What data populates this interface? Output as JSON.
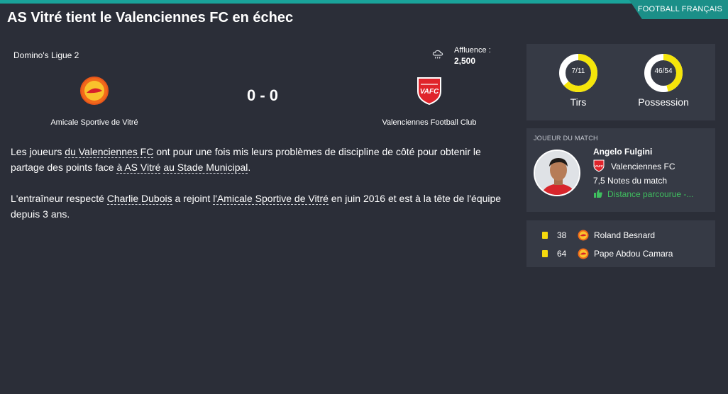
{
  "category": "FOOTBALL FRANÇAIS",
  "headline": "AS Vitré tient le Valenciennes FC en échec",
  "match": {
    "competition": "Domino's Ligue 2",
    "attendance_label": "Affluence :",
    "attendance_value": "2,500",
    "weather_icon": "cloud-rain-icon",
    "score": "0 - 0",
    "home_team": "Amicale Sportive de Vitré",
    "away_team": "Valenciennes Football Club"
  },
  "article": {
    "p1": {
      "t1": "Les joueurs ",
      "link1": "du Valenciennes FC",
      "t2": " ont pour une fois mis leurs problèmes de discipline de côté pour obtenir le partage des points face ",
      "link2": "à AS Vitré",
      "t3": " ",
      "link3": "au Stade Municipal",
      "t4": "."
    },
    "p2": {
      "t1": "L'entraîneur respecté ",
      "link1": "Charlie Dubois",
      "t2": " a rejoint ",
      "link2": "l'Amicale Sportive de Vitré",
      "t3": " en juin 2016 et est à la tête de l'équipe depuis 3 ans."
    }
  },
  "stats": [
    {
      "label": "Tirs",
      "value_text": "7/11",
      "fraction": 0.636
    },
    {
      "label": "Possession",
      "value_text": "46/54",
      "fraction": 0.46
    }
  ],
  "motm": {
    "title": "JOUEUR DU MATCH",
    "player": "Angelo Fulgini",
    "club": "Valenciennes FC",
    "rating": "7,5",
    "rating_label": "Notes du match",
    "detail": "Distance parcourue -..."
  },
  "events": [
    {
      "minute": "38",
      "player": "Roland Besnard",
      "card": "yellow"
    },
    {
      "minute": "64",
      "player": "Pape Abdou Camara",
      "card": "yellow"
    }
  ],
  "colors": {
    "accent": "#1aa39a",
    "donut_yellow": "#f5e50a",
    "donut_white": "#ffffff",
    "vafc_red": "#e0242b",
    "vitre_orange": "#f26a1b",
    "positive_green": "#3fbf5f"
  }
}
